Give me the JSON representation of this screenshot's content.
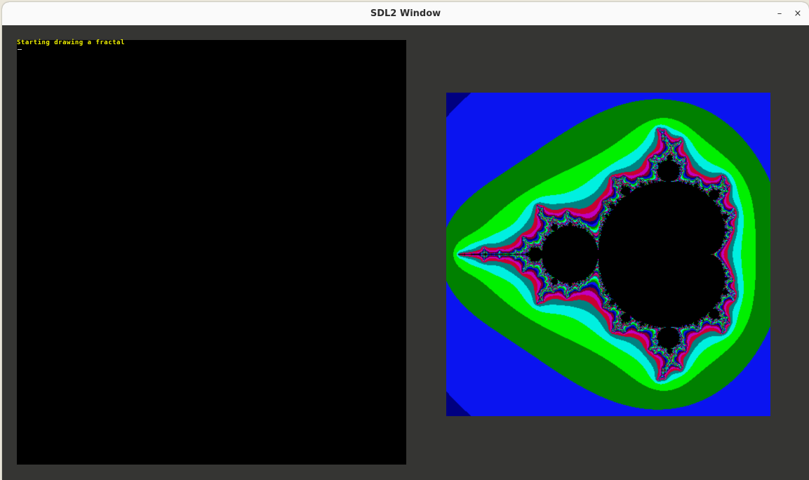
{
  "window": {
    "title": "SDL2 Window",
    "minimize_label": "–",
    "close_label": "×"
  },
  "console": {
    "text": "Starting drawing a fractal",
    "cursor": "_"
  },
  "fractal": {
    "type": "mandelbrot",
    "colors": {
      "background": "#000000",
      "band_navy": "#000080",
      "band_blue": "#0a14f0",
      "band_dark_green": "#008000",
      "band_green": "#00f000",
      "band_cyan": "#00f0e0",
      "band_teal": "#008080",
      "band_red": "#c80030",
      "band_magenta": "#c000c0",
      "band_crimson": "#800020",
      "set_interior": "#000000"
    }
  }
}
